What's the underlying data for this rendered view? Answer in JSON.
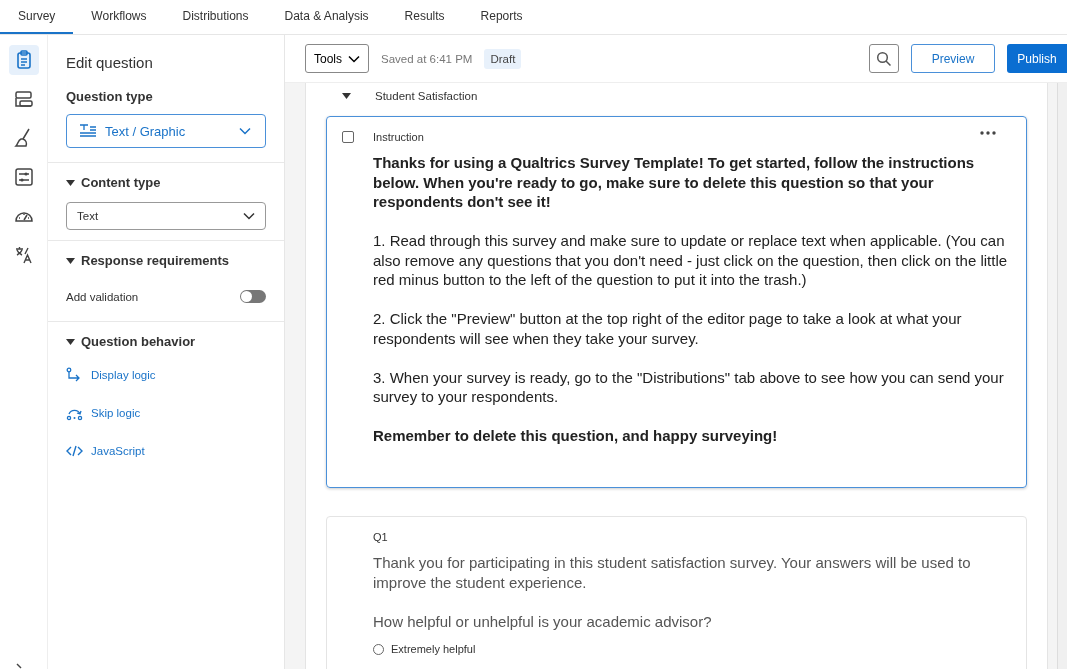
{
  "tabs": [
    {
      "label": "Survey",
      "selected": true
    },
    {
      "label": "Workflows",
      "selected": false
    },
    {
      "label": "Distributions",
      "selected": false
    },
    {
      "label": "Data & Analysis",
      "selected": false
    },
    {
      "label": "Results",
      "selected": false
    },
    {
      "label": "Reports",
      "selected": false
    }
  ],
  "rail": [
    {
      "selected": true
    },
    {
      "selected": false
    },
    {
      "selected": false
    },
    {
      "selected": false
    },
    {
      "selected": false
    },
    {
      "selected": false
    }
  ],
  "panel": {
    "title": "Edit question",
    "question_type_label": "Question type",
    "question_type": "Text / Graphic",
    "sections": [
      {
        "title": "Content type",
        "expanded": true,
        "kind": "select",
        "value": "Text"
      },
      {
        "title": "Response requirements",
        "expanded": true,
        "kind": "toggle",
        "label": "Add validation",
        "on": false
      },
      {
        "title": "Question behavior",
        "expanded": true,
        "kind": "links",
        "links": [
          "Display logic",
          "Skip logic",
          "JavaScript"
        ]
      }
    ]
  },
  "toolbar": {
    "tools": "Tools",
    "saved": "Saved at 6:41 PM",
    "status": "Draft",
    "preview": "Preview",
    "publish": "Publish"
  },
  "block": {
    "title": "Student Satisfaction",
    "expanded": true
  },
  "questions": [
    {
      "label": "Instruction",
      "selected": true,
      "checked": false,
      "paragraphs": [
        {
          "text": "Thanks for using a Qualtrics Survey Template! To get started, follow the instructions below. When you're ready to go, make sure to delete this question so that your respondents don't see it!",
          "bold": true
        },
        {
          "text": "1. Read through this survey and make sure to update or replace text when applicable. (You can also remove any questions that you don't need - just click on the question, then click on the little red minus button to the left of the question to put it into the trash.)",
          "bold": false
        },
        {
          "text": "2. Click the \"Preview\" button at the top right of the editor page to take a look at what your respondents will see when they take your survey.",
          "bold": false
        },
        {
          "text": "3. When your survey is ready, go to the \"Distributions\" tab above to see how you can send your survey to your respondents.",
          "bold": false
        },
        {
          "text": "Remember to delete this question, and happy surveying!",
          "bold": true
        }
      ]
    },
    {
      "label": "Q1",
      "selected": false,
      "paragraphs": [
        {
          "text": "Thank you for participating in this student satisfaction survey. Your answers will be used to improve the student experience.",
          "bold": false
        },
        {
          "text": "How helpful or unhelpful is your academic advisor?",
          "bold": false
        }
      ],
      "options": [
        {
          "label": "Extremely helpful",
          "selected": false
        }
      ]
    }
  ]
}
